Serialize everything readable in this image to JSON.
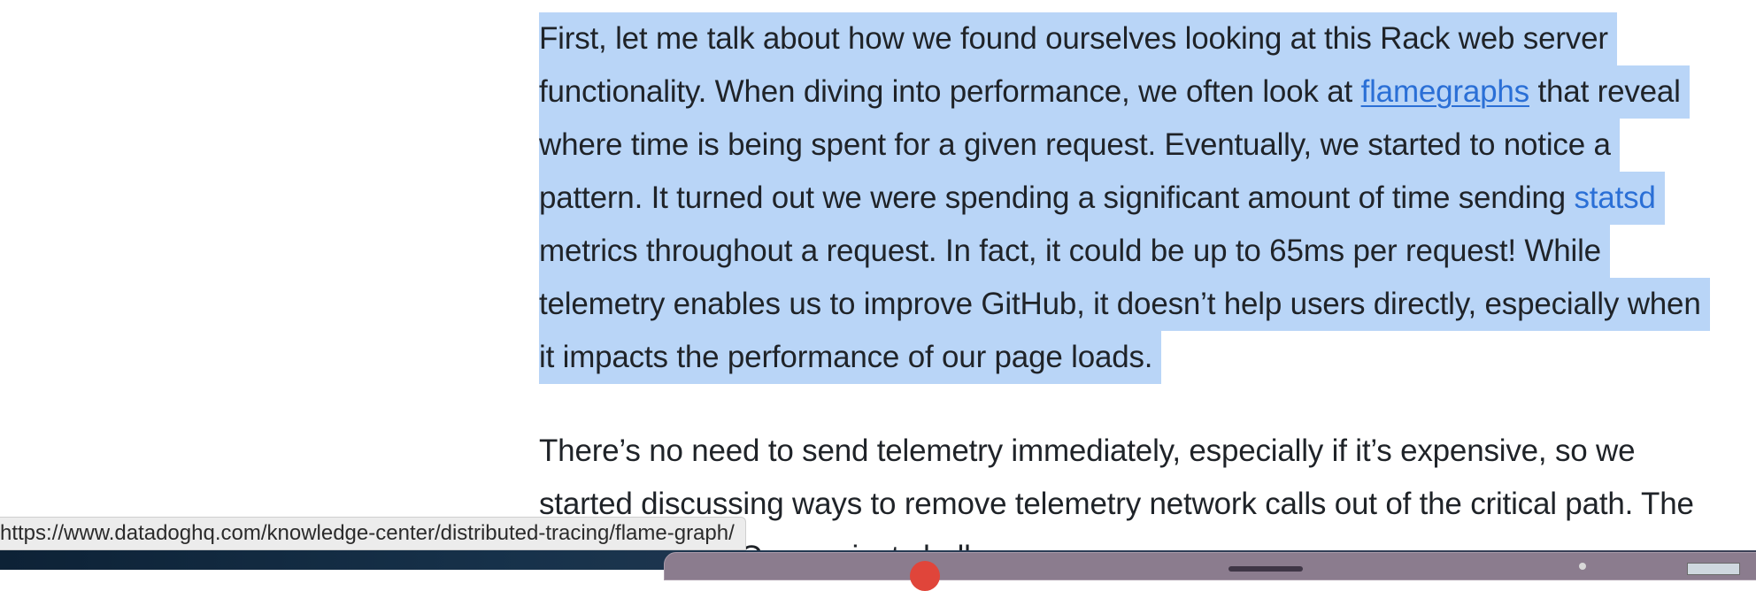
{
  "article": {
    "paragraph1": {
      "line1": "First, let me talk about how we found ourselves looking at this Rack web server",
      "line2_before": "functionality. When diving into performance, we often look at ",
      "line2_link": "flamegraphs",
      "line2_after": " that reveal",
      "line3": "where time is being spent for a given request. Eventually, we started to notice a",
      "line4_before": "pattern. It turned out we were spending a significant amount of time sending ",
      "line4_link": "statsd",
      "line5": "metrics throughout a request. In fact, it could be up to 65ms per request! While",
      "line6": "telemetry enables us to improve GitHub, it doesn’t help users directly, especially when",
      "line7": "it impacts the performance of our page loads."
    },
    "paragraph2": {
      "line1": "There’s no need to send telemetry immediately, especially if it’s expensive, so we",
      "line2": "started discussing ways to remove telemetry network calls out of the critical path. The",
      "line3": "conversation: “Can we just shell"
    }
  },
  "status_bar": {
    "hover_url": "https://www.datadoghq.com/knowledge-center/distributed-tracing/flame-graph/"
  },
  "colors": {
    "selection": "#b9d5f7",
    "link": "#2a6fd6",
    "text": "#1f2328"
  }
}
